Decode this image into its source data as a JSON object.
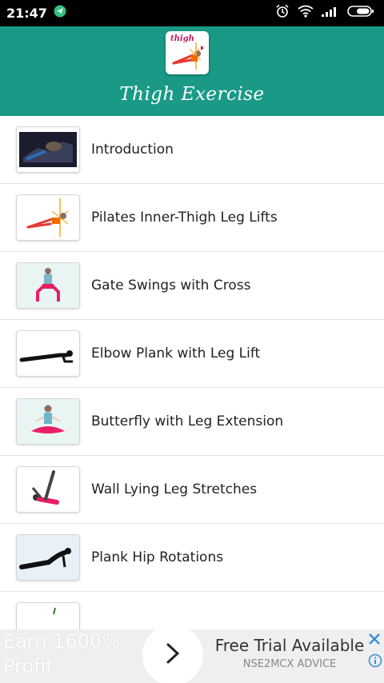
{
  "status_bar": {
    "time": "21:47",
    "icons": [
      "location-icon",
      "alarm-icon",
      "wifi-icon",
      "signal-icon",
      "battery-icon"
    ]
  },
  "header": {
    "app_icon_label": "thigh",
    "title": "Thigh Exercise",
    "color": "#1a9a86"
  },
  "exercises": [
    {
      "label": "Introduction"
    },
    {
      "label": "Pilates Inner-Thigh Leg Lifts"
    },
    {
      "label": "Gate Swings with Cross"
    },
    {
      "label": "Elbow Plank with Leg Lift"
    },
    {
      "label": "Butterfly with Leg Extension"
    },
    {
      "label": "Wall Lying Leg Stretches"
    },
    {
      "label": "Plank Hip Rotations"
    }
  ],
  "ad": {
    "left_text_line1": "Earn 1600%",
    "left_text_line2": "Profit",
    "title": "Free Trial Available",
    "subtitle": "NSE2MCX ADVICE"
  }
}
